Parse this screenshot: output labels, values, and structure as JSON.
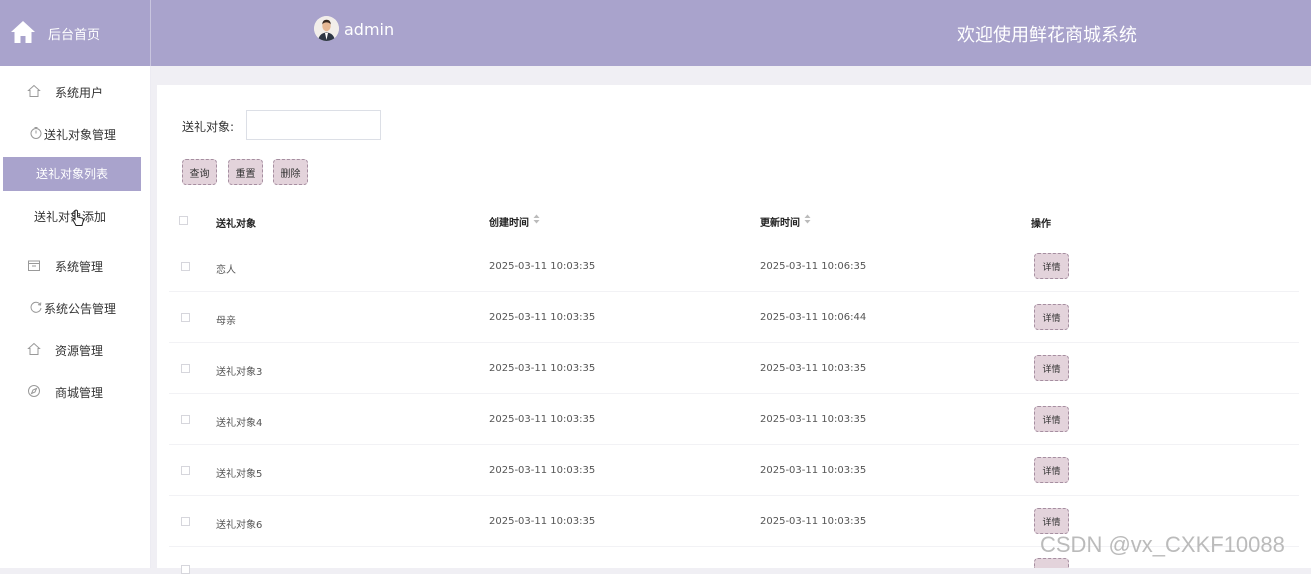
{
  "header": {
    "brand_title": "后台首页",
    "user_name": "admin",
    "welcome": "欢迎使用鲜花商城系统"
  },
  "sidebar": {
    "items": [
      {
        "label": "系统用户",
        "icon": "home-outline-icon"
      },
      {
        "label": "送礼对象管理",
        "icon": "timer-icon"
      },
      {
        "label": "系统管理",
        "icon": "box-icon"
      },
      {
        "label": "系统公告管理",
        "icon": "refresh-circle-icon"
      },
      {
        "label": "资源管理",
        "icon": "home-outline-icon"
      },
      {
        "label": "商城管理",
        "icon": "compass-icon"
      }
    ],
    "submenu": {
      "active": "送礼对象列表",
      "other": "送礼对象添加"
    }
  },
  "search": {
    "label": "送礼对象:",
    "value": "",
    "placeholder": ""
  },
  "buttons": {
    "query": "查询",
    "reset": "重置",
    "delete": "删除"
  },
  "table": {
    "headers": {
      "name": "送礼对象",
      "created": "创建时间",
      "updated": "更新时间",
      "actions": "操作"
    },
    "detail_label": "详情",
    "rows": [
      {
        "name": "恋人",
        "created": "2025-03-11 10:03:35",
        "updated": "2025-03-11 10:06:35"
      },
      {
        "name": "母亲",
        "created": "2025-03-11 10:03:35",
        "updated": "2025-03-11 10:06:44"
      },
      {
        "name": "送礼对象3",
        "created": "2025-03-11 10:03:35",
        "updated": "2025-03-11 10:03:35"
      },
      {
        "name": "送礼对象4",
        "created": "2025-03-11 10:03:35",
        "updated": "2025-03-11 10:03:35"
      },
      {
        "name": "送礼对象5",
        "created": "2025-03-11 10:03:35",
        "updated": "2025-03-11 10:03:35"
      },
      {
        "name": "送礼对象6",
        "created": "2025-03-11 10:03:35",
        "updated": "2025-03-11 10:03:35"
      }
    ]
  },
  "watermark": "CSDN @vx_CXKF10088",
  "colors": {
    "accent": "#a9a3cc",
    "button_bg": "#e3d3db",
    "button_border": "#a58ea0"
  }
}
